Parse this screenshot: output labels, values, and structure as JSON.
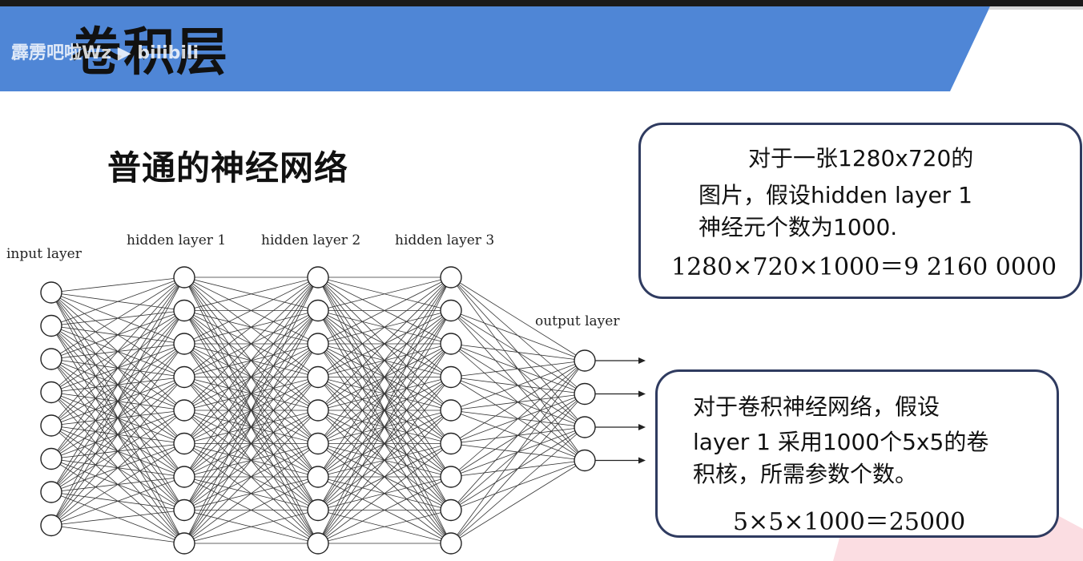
{
  "slide": {
    "title": "卷积层",
    "watermark": "霹雳吧啦Wz ▶ bilibili",
    "subtitle": "普通的神经网络"
  },
  "network": {
    "layers": [
      {
        "label": "input layer",
        "nodes": 8
      },
      {
        "label": "hidden layer 1",
        "nodes": 9
      },
      {
        "label": "hidden layer 2",
        "nodes": 9
      },
      {
        "label": "hidden layer 3",
        "nodes": 9
      },
      {
        "label": "output layer",
        "nodes": 4
      }
    ]
  },
  "box1": {
    "line1": "对于一张1280x720的",
    "line2": "图片，假设hidden layer 1",
    "line3": "神经元个数为1000.",
    "formula": "1280×720×1000＝9 2160 0000"
  },
  "box2": {
    "line1": "对于卷积神经网络，假设",
    "line2": "layer 1 采用1000个5x5的卷",
    "line3": "积核，所需参数个数。",
    "formula": "5×5×1000＝25000"
  },
  "colors": {
    "banner": "#4f86d6",
    "box_border": "#2f3b60",
    "accent_triangle": "#f9d6dc"
  }
}
